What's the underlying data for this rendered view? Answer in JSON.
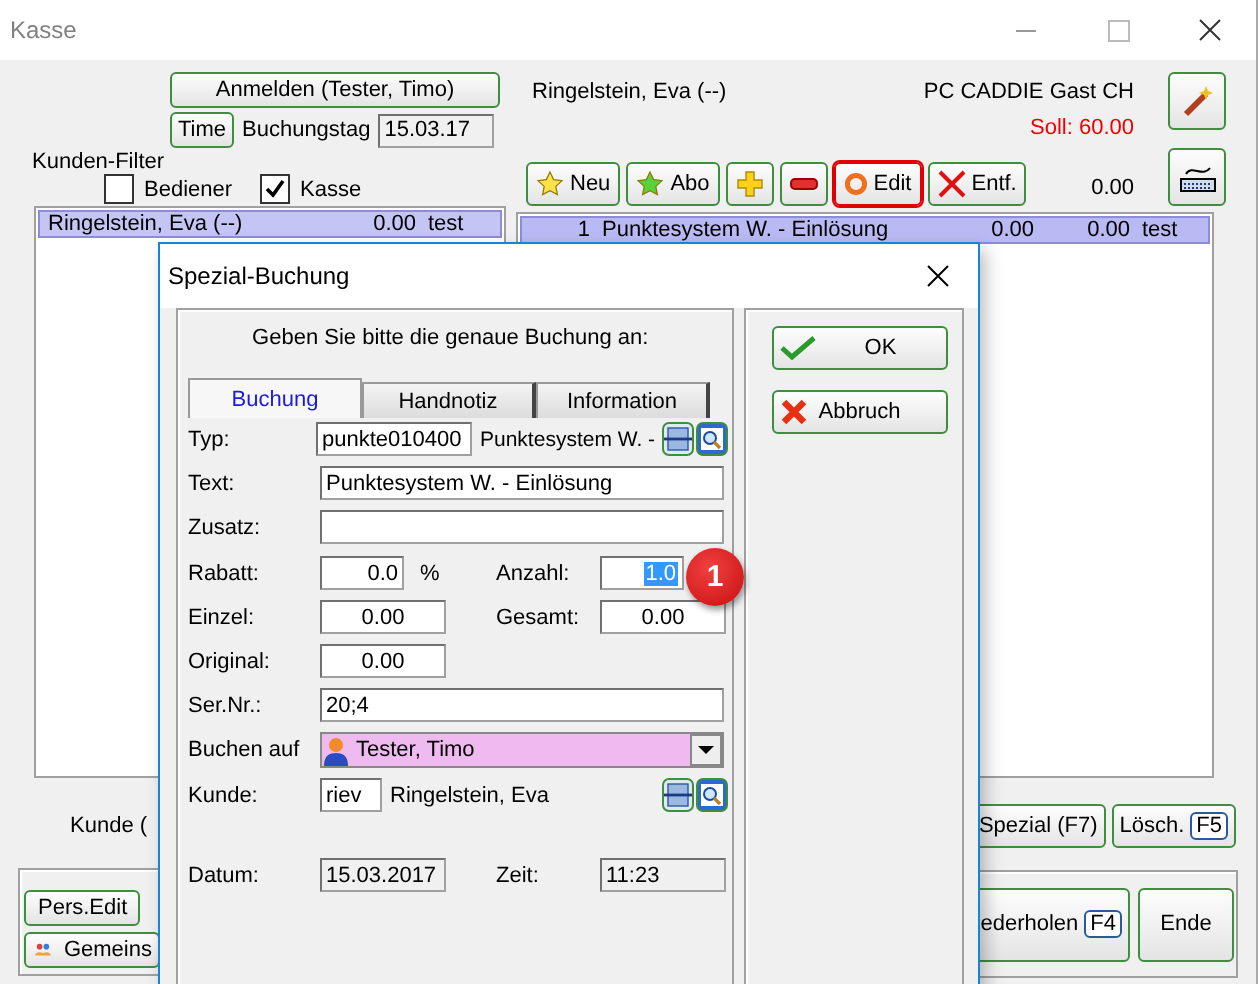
{
  "window": {
    "title": "Kasse"
  },
  "left_panel": {
    "login_button": "Anmelden (Tester, Timo)",
    "time_button": "Time",
    "date_label": "Buchungstag",
    "date_value": "15.03.17",
    "filter_label": "Kunden-Filter",
    "filters": [
      {
        "label": "Bediener",
        "checked": false
      },
      {
        "label": "Kasse",
        "checked": true
      }
    ],
    "customers": [
      {
        "name": "Ringelstein, Eva (--)",
        "amount": "0.00",
        "user": "test",
        "selected": true
      }
    ],
    "customer_label": "Kunde (",
    "buttons": [
      {
        "kind": "text",
        "label": "Pers.Edit"
      },
      {
        "kind": "group",
        "label": "Gemeins"
      }
    ]
  },
  "right_panel": {
    "customer": "Ringelstein, Eva (--)",
    "tariff": "PC CADDIE Gast CH",
    "balance": "Soll: 60.00",
    "toolbar": [
      {
        "kind": "star",
        "label": "Neu",
        "highlighted": false
      },
      {
        "kind": "green-star",
        "label": "Abo",
        "highlighted": false
      },
      {
        "kind": "plus",
        "highlighted": false
      },
      {
        "kind": "minus",
        "highlighted": false
      },
      {
        "kind": "ring",
        "label": "Edit",
        "highlighted": true
      },
      {
        "kind": "cross",
        "label": "Entf.",
        "highlighted": false
      }
    ],
    "total": "0.00",
    "items": [
      {
        "number": "1",
        "text": "Punktesystem W. - Einlösung",
        "price": "0.00",
        "total": "0.00",
        "user": "test",
        "selected": true
      }
    ],
    "buttons": [
      {
        "label": "Spezial (F7)"
      },
      {
        "label": "Lösch.",
        "key": "F5"
      }
    ],
    "bottom_buttons": [
      {
        "label": "ederholen",
        "key": "F4"
      },
      {
        "label": "Ende"
      }
    ]
  },
  "dialog": {
    "title": "Spezial-Buchung",
    "prompt": "Geben Sie bitte die genaue Buchung an:",
    "tabs": [
      {
        "label": "Buchung",
        "selected": true
      },
      {
        "label": "Handnotiz",
        "selected": false
      },
      {
        "label": "Information",
        "selected": false
      }
    ],
    "type": {
      "label": "Typ:",
      "value": "punkte010400",
      "description": "Punktesystem W. -"
    },
    "text": {
      "label": "Text:",
      "value": "Punktesystem W. - Einlösung"
    },
    "extra": {
      "label": "Zusatz:"
    },
    "discount": {
      "label": "Rabatt:",
      "value": "0.0",
      "unit": "%"
    },
    "quantity": {
      "label": "Anzahl:",
      "value": "1.0",
      "selected": true
    },
    "unit_price": {
      "label": "Einzel:",
      "value": "0.00"
    },
    "total": {
      "label": "Gesamt:",
      "value": "0.00"
    },
    "original": {
      "label": "Original:",
      "value": "0.00"
    },
    "serial": {
      "label": "Ser.Nr.:",
      "value": "20;4"
    },
    "book_to": {
      "label": "Buchen auf",
      "value": "Tester, Timo"
    },
    "customer": {
      "label": "Kunde:",
      "value": "riev",
      "name": "Ringelstein, Eva"
    },
    "date": {
      "label": "Datum:",
      "value": "15.03.2017"
    },
    "time": {
      "label": "Zeit:",
      "value": "11:23"
    },
    "buttons": [
      {
        "kind": "ok",
        "label": "OK"
      },
      {
        "kind": "cancel",
        "label": "Abbruch"
      }
    ],
    "badge": "1"
  }
}
